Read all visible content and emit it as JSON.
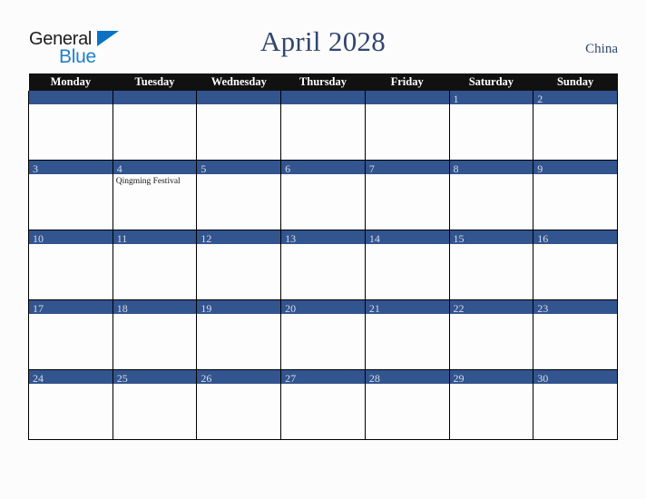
{
  "brand": {
    "name_part1": "General",
    "name_part2": "Blue",
    "triangle_icon": "triangle-icon"
  },
  "header": {
    "title": "April 2028",
    "country": "China"
  },
  "colors": {
    "accent_blue": "#32548f",
    "header_black": "#111111",
    "title_navy": "#31456e",
    "logo_blue": "#1f7fd0",
    "page_background": "#fcfcfd"
  },
  "calendar": {
    "weekday_headers": [
      "Monday",
      "Tuesday",
      "Wednesday",
      "Thursday",
      "Friday",
      "Saturday",
      "Sunday"
    ],
    "weeks": [
      [
        {
          "day": "",
          "events": []
        },
        {
          "day": "",
          "events": []
        },
        {
          "day": "",
          "events": []
        },
        {
          "day": "",
          "events": []
        },
        {
          "day": "",
          "events": []
        },
        {
          "day": "1",
          "events": []
        },
        {
          "day": "2",
          "events": []
        }
      ],
      [
        {
          "day": "3",
          "events": []
        },
        {
          "day": "4",
          "events": [
            "Qingming Festival"
          ]
        },
        {
          "day": "5",
          "events": []
        },
        {
          "day": "6",
          "events": []
        },
        {
          "day": "7",
          "events": []
        },
        {
          "day": "8",
          "events": []
        },
        {
          "day": "9",
          "events": []
        }
      ],
      [
        {
          "day": "10",
          "events": []
        },
        {
          "day": "11",
          "events": []
        },
        {
          "day": "12",
          "events": []
        },
        {
          "day": "13",
          "events": []
        },
        {
          "day": "14",
          "events": []
        },
        {
          "day": "15",
          "events": []
        },
        {
          "day": "16",
          "events": []
        }
      ],
      [
        {
          "day": "17",
          "events": []
        },
        {
          "day": "18",
          "events": []
        },
        {
          "day": "19",
          "events": []
        },
        {
          "day": "20",
          "events": []
        },
        {
          "day": "21",
          "events": []
        },
        {
          "day": "22",
          "events": []
        },
        {
          "day": "23",
          "events": []
        }
      ],
      [
        {
          "day": "24",
          "events": []
        },
        {
          "day": "25",
          "events": []
        },
        {
          "day": "26",
          "events": []
        },
        {
          "day": "27",
          "events": []
        },
        {
          "day": "28",
          "events": []
        },
        {
          "day": "29",
          "events": []
        },
        {
          "day": "30",
          "events": []
        }
      ]
    ]
  }
}
